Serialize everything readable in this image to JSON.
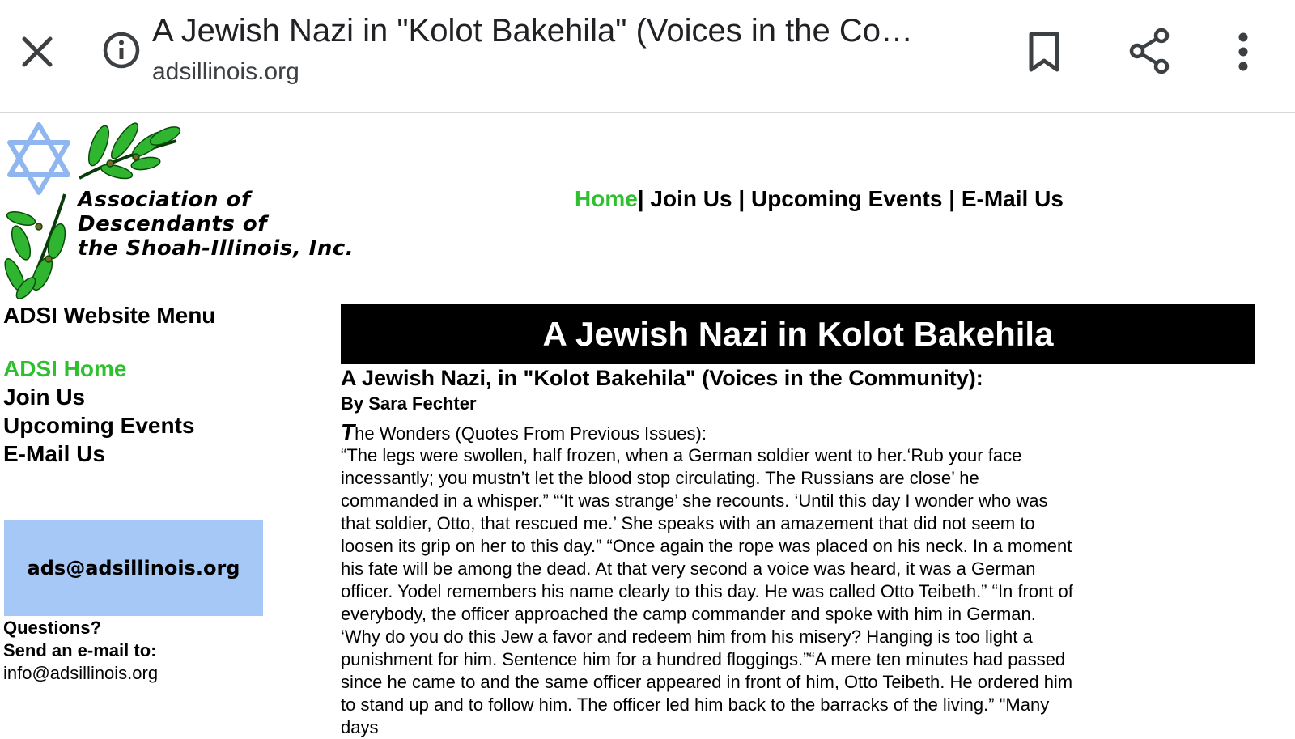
{
  "browser": {
    "title": "A Jewish Nazi in \"Kolot Bakehila\" (Voices in the Co…",
    "url": "adsillinois.org"
  },
  "logo": {
    "line1": "Association of",
    "line2": "Descendants of",
    "line3": "the Shoah-Illinois, Inc."
  },
  "top_nav": {
    "home": "Home",
    "join": "Join Us",
    "events": "Upcoming Events",
    "email": "E-Mail Us",
    "sep": "|"
  },
  "side_menu": {
    "title": "ADSI Website Menu",
    "items": [
      "ADSI Home",
      "Join Us",
      "Upcoming Events",
      "E-Mail Us"
    ]
  },
  "email_banner": "ads@adsillinois.org",
  "questions": {
    "line1": "Questions?",
    "line2": "Send an e-mail to:",
    "email": "info@adsillinois.org"
  },
  "article": {
    "header": "A Jewish Nazi in Kolot Bakehila",
    "subtitle": "A Jewish Nazi, in \"Kolot Bakehila\" (Voices in the Community):",
    "byline": "By Sara Fechter",
    "lead_initial": "T",
    "lead_rest": "he Wonders (Quotes From Previous Issues):",
    "body": "“The legs were swollen, half frozen, when a German soldier went to her.‘Rub your face incessantly; you mustn’t let the blood stop circulating. The Russians are close’ he commanded in a whisper.” “‘It was strange’ she recounts. ‘Until this day I wonder who was that soldier, Otto, that rescued me.’ She speaks with an amazement that did not seem to loosen its grip on her to this day.” “Once again the rope was placed on his neck. In a moment his fate will be among the dead. At that very second a voice was heard, it was a German officer. Yodel remembers his name clearly to this day. He was called Otto Teibeth.” “In front of everybody, the officer approached the camp commander and spoke with him in German. ‘Why do you do this Jew a favor and redeem him from his misery? Hanging is too light a punishment for him. Sentence him for a hundred floggings.”“A mere ten minutes had passed since he came to and the same officer appeared in front of him, Otto Teibeth. He ordered him to stand up and to follow him. The officer led him back to the barracks of the living.” \"Many days"
  }
}
